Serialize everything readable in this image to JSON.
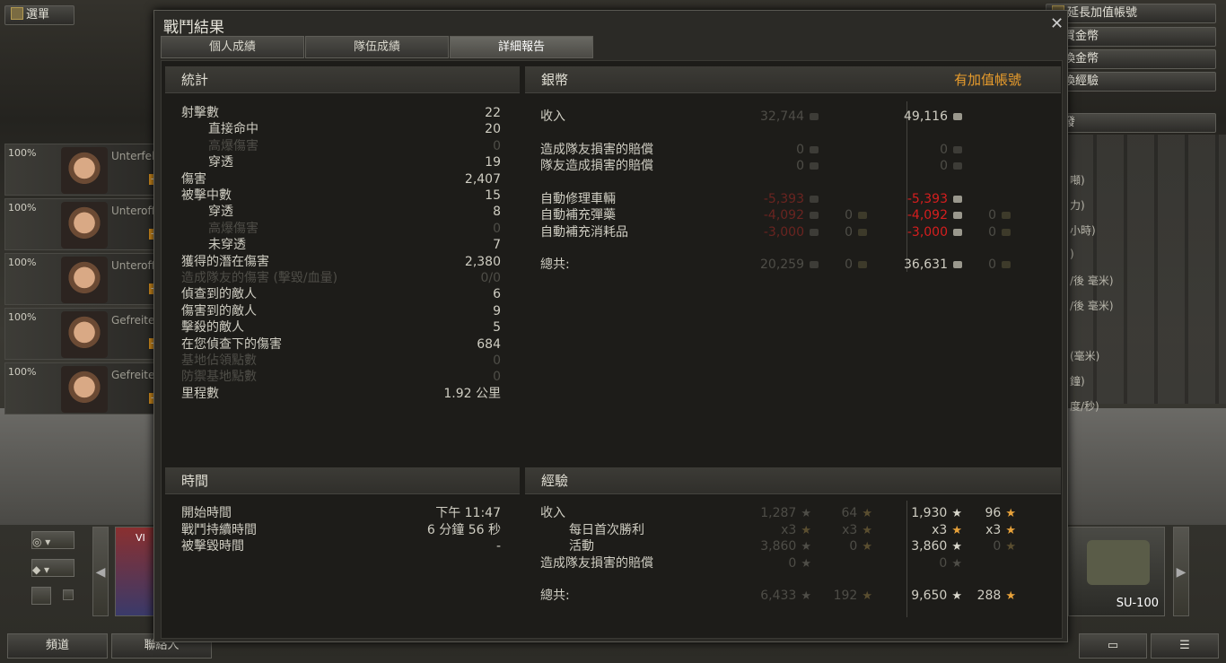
{
  "topbar": {
    "menu": "選單",
    "right_buttons": [
      "延長加值帳號",
      "購買金幣",
      "兌換金幣",
      "轉換經驗",
      "研發"
    ]
  },
  "sidepanel": [
    "噸)",
    "力)",
    "小時)",
    ")",
    "/後 毫米)",
    "/後 毫米)",
    "(毫米)",
    "鐘)",
    "度/秒)"
  ],
  "crew": [
    {
      "pct": "100%",
      "name": "Unterfeldwebel"
    },
    {
      "pct": "100%",
      "name": "Unteroffizier"
    },
    {
      "pct": "100%",
      "name": "Unteroffizier"
    },
    {
      "pct": "100%",
      "name": "Gefreiter"
    },
    {
      "pct": "100%",
      "name": "Gefreiter"
    }
  ],
  "carousel": {
    "tier": "VI",
    "tank": "SU-100"
  },
  "bottom": {
    "channels": "頻道",
    "contacts": "聯絡人"
  },
  "dialog": {
    "title": "戰鬥結果",
    "tabs": [
      "個人成績",
      "隊伍成績",
      "詳細報告"
    ]
  },
  "stats": {
    "header": "統計",
    "rows": [
      {
        "label": "射擊數",
        "value": "22",
        "indent": false,
        "dim": false
      },
      {
        "label": "直接命中",
        "value": "20",
        "indent": true,
        "dim": false
      },
      {
        "label": "高爆傷害",
        "value": "0",
        "indent": true,
        "dim": true
      },
      {
        "label": "穿透",
        "value": "19",
        "indent": true,
        "dim": false
      },
      {
        "label": "傷害",
        "value": "2,407",
        "indent": false,
        "dim": false
      },
      {
        "label": "被擊中數",
        "value": "15",
        "indent": false,
        "dim": false
      },
      {
        "label": "穿透",
        "value": "8",
        "indent": true,
        "dim": false
      },
      {
        "label": "高爆傷害",
        "value": "0",
        "indent": true,
        "dim": true
      },
      {
        "label": "未穿透",
        "value": "7",
        "indent": true,
        "dim": false
      },
      {
        "label": "獲得的潛在傷害",
        "value": "2,380",
        "indent": false,
        "dim": false
      },
      {
        "label": "造成隊友的傷害 (擊毀/血量)",
        "value": "0/0",
        "indent": false,
        "dim": true
      },
      {
        "label": "偵查到的敵人",
        "value": "6",
        "indent": false,
        "dim": false
      },
      {
        "label": "傷害到的敵人",
        "value": "9",
        "indent": false,
        "dim": false
      },
      {
        "label": "擊殺的敵人",
        "value": "5",
        "indent": false,
        "dim": false
      },
      {
        "label": "在您偵查下的傷害",
        "value": "684",
        "indent": false,
        "dim": false
      },
      {
        "label": "基地佔領點數",
        "value": "0",
        "indent": false,
        "dim": true
      },
      {
        "label": "防禦基地點數",
        "value": "0",
        "indent": false,
        "dim": true
      },
      {
        "label": "里程數",
        "value": "1.92 公里",
        "indent": false,
        "dim": false
      }
    ]
  },
  "credits": {
    "header": "銀幣",
    "premium_label": "有加值帳號",
    "rows": [
      {
        "label": "收入",
        "base": "32,744",
        "base_gold": "",
        "prem": "49,116",
        "prem_gold": "",
        "red": false,
        "gap": 0
      },
      {
        "label": "造成隊友損害的賠償",
        "base": "0",
        "base_gold": "",
        "prem": "0",
        "prem_gold": "",
        "red": false,
        "gap": 1,
        "premdim": true
      },
      {
        "label": "隊友造成損害的賠償",
        "base": "0",
        "base_gold": "",
        "prem": "0",
        "prem_gold": "",
        "red": false,
        "gap": 0,
        "premdim": true
      },
      {
        "label": "自動修理車輛",
        "base": "-5,393",
        "base_gold": "",
        "prem": "-5,393",
        "prem_gold": "",
        "red": true,
        "gap": 1
      },
      {
        "label": "自動補充彈藥",
        "base": "-4,092",
        "base_gold": "0",
        "prem": "-4,092",
        "prem_gold": "0",
        "red": true,
        "gap": 0
      },
      {
        "label": "自動補充消耗品",
        "base": "-3,000",
        "base_gold": "0",
        "prem": "-3,000",
        "prem_gold": "0",
        "red": true,
        "gap": 0
      },
      {
        "label": "總共:",
        "base": "20,259",
        "base_gold": "0",
        "prem": "36,631",
        "prem_gold": "0",
        "red": false,
        "gap": 1
      }
    ]
  },
  "time": {
    "header": "時間",
    "rows": [
      {
        "label": "開始時間",
        "value": "下午 11:47"
      },
      {
        "label": "戰鬥持續時間",
        "value": "6 分鐘 56 秒"
      },
      {
        "label": "被擊毀時間",
        "value": "-"
      }
    ]
  },
  "xp": {
    "header": "經驗",
    "rows": [
      {
        "label": "收入",
        "indent": false,
        "base": "1,287",
        "base_f": "64",
        "prem": "1,930",
        "prem_f": "96",
        "gap": 0
      },
      {
        "label": "每日首次勝利",
        "indent": true,
        "base": "x3",
        "base_f": "x3",
        "prem": "x3",
        "prem_f": "x3",
        "gap": 0,
        "bonus": true
      },
      {
        "label": "活動",
        "indent": true,
        "base": "3,860",
        "base_f": "0",
        "prem": "3,860",
        "prem_f": "0",
        "gap": 0
      },
      {
        "label": "造成隊友損害的賠償",
        "indent": false,
        "base": "0",
        "base_f": "",
        "prem": "0",
        "prem_f": "",
        "gap": 0,
        "premdim": true
      },
      {
        "label": "總共:",
        "indent": false,
        "base": "6,433",
        "base_f": "192",
        "prem": "9,650",
        "prem_f": "288",
        "gap": 1
      }
    ]
  }
}
